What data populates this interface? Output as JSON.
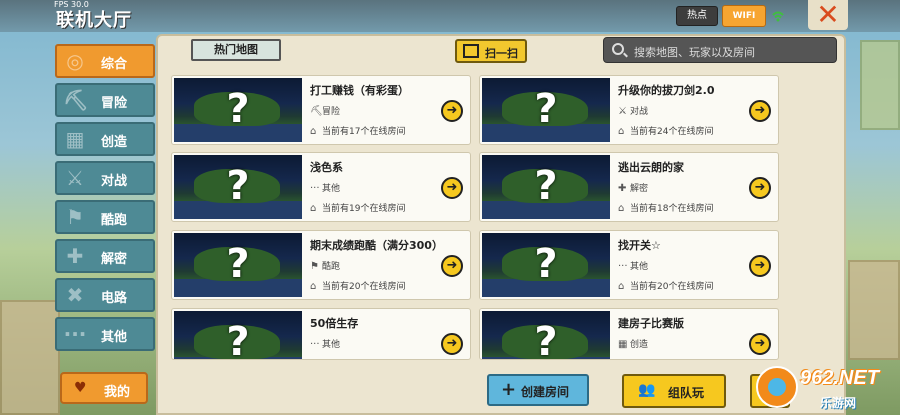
{
  "header": {
    "fps": "FPS 30.0",
    "title": "联机大厅",
    "hot_label": "热点",
    "wifi_label": "WIFI",
    "close_icon": "close-icon"
  },
  "sidebar": {
    "items": [
      {
        "label": "综合",
        "icon": "swirl-icon",
        "active": true
      },
      {
        "label": "冒险",
        "icon": "pickaxe-icon",
        "active": false
      },
      {
        "label": "创造",
        "icon": "blocks-icon",
        "active": false
      },
      {
        "label": "对战",
        "icon": "swords-icon",
        "active": false
      },
      {
        "label": "酷跑",
        "icon": "runner-icon",
        "active": false
      },
      {
        "label": "解密",
        "icon": "puzzle-icon",
        "active": false
      },
      {
        "label": "电路",
        "icon": "wrench-icon",
        "active": false
      },
      {
        "label": "其他",
        "icon": "ellipsis-icon",
        "active": false
      }
    ],
    "mine_label": "我的"
  },
  "toolbar": {
    "hot_maps_label": "热门地图",
    "scan_label": "扫一扫",
    "search_placeholder": "搜索地图、玩家以及房间"
  },
  "rooms": [
    {
      "name": "打工赚钱（有彩蛋）",
      "category": "冒险",
      "cat_icon": "pickaxe-icon",
      "rooms": "当前有17个在线房间"
    },
    {
      "name": "升级你的拔刀剑2.0",
      "category": "对战",
      "cat_icon": "swords-icon",
      "rooms": "当前有24个在线房间"
    },
    {
      "name": "浅色系",
      "category": "其他",
      "cat_icon": "ellipsis-icon",
      "rooms": "当前有19个在线房间"
    },
    {
      "name": "逃出云朗的家",
      "category": "解密",
      "cat_icon": "puzzle-icon",
      "rooms": "当前有18个在线房间"
    },
    {
      "name": "期末成绩跑酷（满分300）",
      "category": "酷跑",
      "cat_icon": "runner-icon",
      "rooms": "当前有20个在线房间"
    },
    {
      "name": "找开关☆",
      "category": "其他",
      "cat_icon": "ellipsis-icon",
      "rooms": "当前有20个在线房间"
    },
    {
      "name": "50倍生存",
      "category": "其他",
      "cat_icon": "ellipsis-icon",
      "rooms": ""
    },
    {
      "name": "建房子比赛版",
      "category": "创造",
      "cat_icon": "blocks-icon",
      "rooms": ""
    }
  ],
  "bottom": {
    "create_label": "创建房间",
    "team_label": "组队玩"
  },
  "watermark": {
    "number": "962.NET",
    "text": "乐游网"
  },
  "colors": {
    "accent_orange": "#f09a2f",
    "sidebar_teal": "#4e8a95",
    "button_yellow": "#f6c81f",
    "create_blue": "#5fb6dc",
    "close_red": "#d94c1e"
  }
}
